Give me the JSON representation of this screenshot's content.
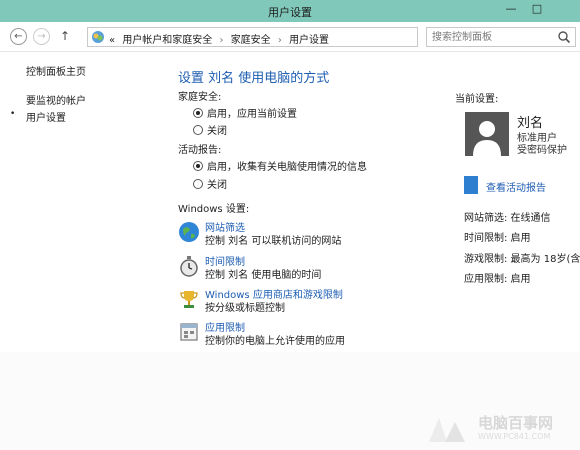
{
  "window": {
    "title": "用户设置",
    "minimize": "—",
    "maximize": "□"
  },
  "address": {
    "prefix": "«",
    "crumbs": [
      "用户帐户和家庭安全",
      "家庭安全",
      "用户设置"
    ],
    "separator": "›",
    "search_placeholder": "搜索控制面板"
  },
  "icons": {
    "back": "arrow-left-icon",
    "forward": "arrow-right-icon",
    "up": "arrow-up-icon",
    "refresh": "refresh-icon",
    "search": "search-icon"
  },
  "sidebar": {
    "home": "控制面板主页",
    "items": [
      "要监视的帐户",
      "用户设置"
    ],
    "active_index": 1
  },
  "main": {
    "heading": "设置 刘名 使用电脑的方式",
    "family_safety": {
      "label": "家庭安全:",
      "options": [
        "启用，应用当前设置",
        "关闭"
      ],
      "selected": 0
    },
    "activity_report": {
      "label": "活动报告:",
      "options": [
        "启用，收集有关电脑使用情况的信息",
        "关闭"
      ],
      "selected": 0
    },
    "windows_settings": {
      "label": "Windows 设置:",
      "items": [
        {
          "title": "网站筛选",
          "desc": "控制 刘名 可以联机访问的网站",
          "icon": "globe-icon"
        },
        {
          "title": "时间限制",
          "desc": "控制 刘名 使用电脑的时间",
          "icon": "stopwatch-icon"
        },
        {
          "title": "Windows 应用商店和游戏限制",
          "desc": "按分级或标题控制",
          "icon": "trophy-icon"
        },
        {
          "title": "应用限制",
          "desc": "控制你的电脑上允许使用的应用",
          "icon": "app-window-icon"
        }
      ]
    }
  },
  "current": {
    "label": "当前设置:",
    "user_name": "刘名",
    "user_type": "标准用户",
    "protection": "受密码保护",
    "report_link": "查看活动报告",
    "info": [
      "网站筛选: 在线通信",
      "时间限制: 启用",
      "游戏限制: 最高为 18岁(含)以",
      "应用限制: 启用"
    ]
  },
  "watermark": {
    "name": "电脑百事网",
    "url": "WWW.PC841.COM"
  },
  "colors": {
    "title_bar": "#7fc8ba",
    "link": "#1e5eb3",
    "avatar": "#565656",
    "report_icon": "#2f7fd1"
  }
}
